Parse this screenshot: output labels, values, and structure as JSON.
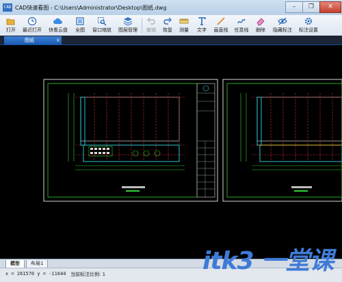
{
  "window": {
    "app_icon": "CAD",
    "title": "CAD快速看图 - C:\\Users\\Administrator\\Desktop\\图纸.dwg",
    "controls": [
      "minimize-icon",
      "restore-icon",
      "close-icon"
    ]
  },
  "toolbar": {
    "items": [
      {
        "label": "打开",
        "icon": "open-folder-icon",
        "enabled": true
      },
      {
        "label": "最近打开",
        "icon": "clock-icon",
        "enabled": true
      },
      {
        "label": "快看云盘",
        "icon": "cloud-icon",
        "enabled": true
      },
      {
        "label": "全图",
        "icon": "fit-all-icon",
        "enabled": true
      },
      {
        "label": "窗口缩放",
        "icon": "window-zoom-icon",
        "enabled": true
      },
      {
        "label": "图层管理",
        "icon": "layers-icon",
        "enabled": true
      },
      {
        "label": "撤销",
        "icon": "undo-icon",
        "enabled": false
      },
      {
        "label": "恢复",
        "icon": "redo-icon",
        "enabled": true
      },
      {
        "label": "测量",
        "icon": "measure-icon",
        "enabled": true
      },
      {
        "label": "文字",
        "icon": "text-icon",
        "enabled": true
      },
      {
        "label": "画直线",
        "icon": "line-icon",
        "enabled": true
      },
      {
        "label": "任意线",
        "icon": "freehand-icon",
        "enabled": true
      },
      {
        "label": "删除",
        "icon": "eraser-icon",
        "enabled": true
      },
      {
        "label": "隐藏标注",
        "icon": "hide-eye-icon",
        "enabled": true
      },
      {
        "label": "标注设置",
        "icon": "settings-icon",
        "enabled": true
      }
    ]
  },
  "document_tab": {
    "label": "图纸",
    "close": "×"
  },
  "layout_tabs": [
    "模型",
    "布局1"
  ],
  "status": {
    "coords": "x = 261570 y = -11644",
    "scale": "当前标注比例: 1"
  },
  "watermark": {
    "text": "itk3 一堂课"
  },
  "colors": {
    "accent": "#1a5db4",
    "canvas": "#000000",
    "drawing_green": "#2fd52f",
    "drawing_red": "#d12f2f",
    "drawing_cyan": "#2fd7e6"
  }
}
